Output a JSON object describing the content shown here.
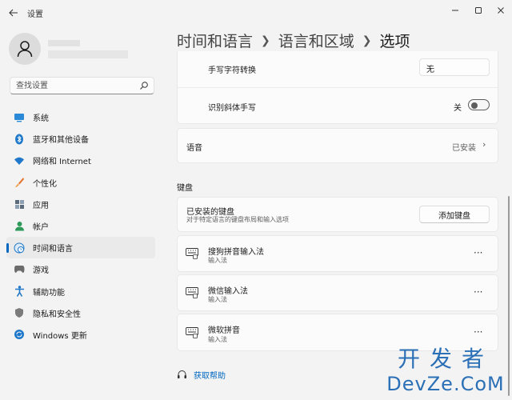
{
  "window": {
    "title": "设置",
    "controls": [
      "minimize-icon",
      "maximize-icon",
      "close-icon"
    ]
  },
  "sidebar": {
    "search_placeholder": "查找设置",
    "items": [
      {
        "label": "系统",
        "icon": "monitor-icon",
        "color": "#0078d4"
      },
      {
        "label": "蓝牙和其他设备",
        "icon": "bluetooth-icon",
        "color": "#0067c0"
      },
      {
        "label": "网络和 Internet",
        "icon": "wifi-icon",
        "color": "#0067c0"
      },
      {
        "label": "个性化",
        "icon": "brush-icon",
        "color": "#e3752d"
      },
      {
        "label": "应用",
        "icon": "apps-icon",
        "color": "#5b6b7c"
      },
      {
        "label": "帐户",
        "icon": "account-icon",
        "color": "#2e9a5a"
      },
      {
        "label": "时间和语言",
        "icon": "globe-clock-icon",
        "color": "#0067c0",
        "active": true
      },
      {
        "label": "游戏",
        "icon": "gamepad-icon",
        "color": "#6b6b6b"
      },
      {
        "label": "辅助功能",
        "icon": "accessibility-icon",
        "color": "#0067c0"
      },
      {
        "label": "隐私和安全性",
        "icon": "shield-icon",
        "color": "#6b6b6b"
      },
      {
        "label": "Windows 更新",
        "icon": "update-icon",
        "color": "#0078d4"
      }
    ]
  },
  "breadcrumb": {
    "part1": "时间和语言",
    "part2": "语言和区域",
    "current": "选项"
  },
  "handwriting": {
    "convert_label": "手写字符转换",
    "convert_value": "无",
    "italic_label": "识别斜体手写",
    "italic_state": "关"
  },
  "speech": {
    "label": "语音",
    "status": "已安装"
  },
  "keyboard": {
    "section_title": "键盘",
    "installed_title": "已安装的键盘",
    "installed_desc": "对于特定语言的键盘布局和输入选项",
    "add_button": "添加键盘",
    "items": [
      {
        "name": "搜狗拼音输入法",
        "sub": "输入法"
      },
      {
        "name": "微信输入法",
        "sub": "输入法"
      },
      {
        "name": "微软拼音",
        "sub": "输入法"
      }
    ]
  },
  "help": {
    "label": "获取帮助"
  },
  "watermark": {
    "line1": "开发者",
    "line2": "DevZe.CoM"
  },
  "accent_color": "#0067c0"
}
